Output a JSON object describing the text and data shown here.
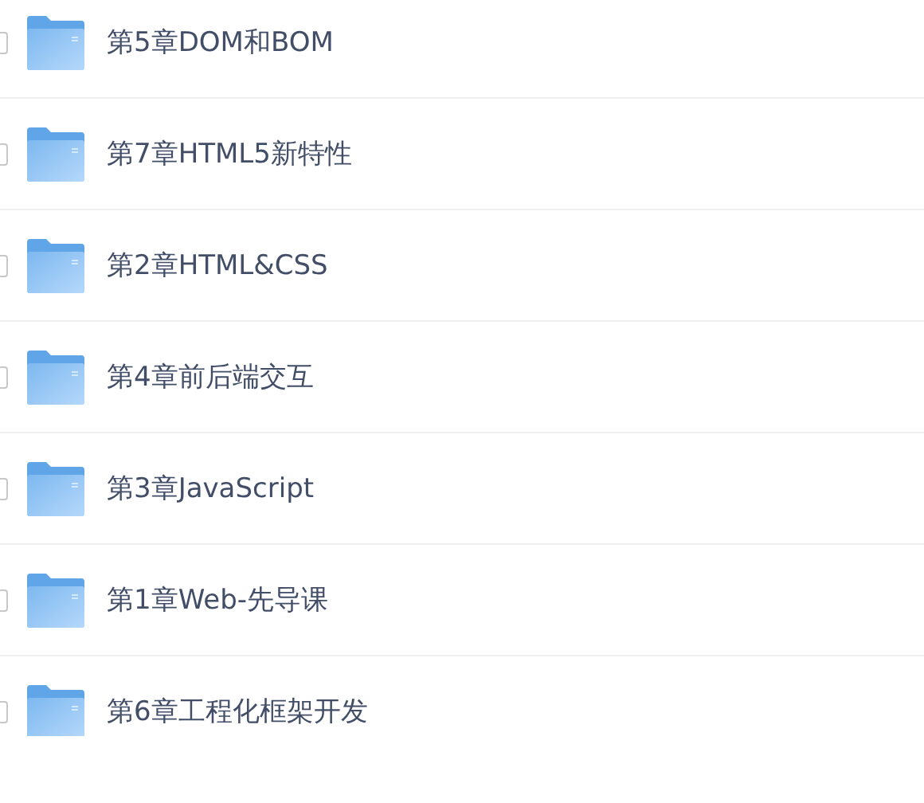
{
  "folders": [
    {
      "name": "第5章DOM和BOM",
      "checked": false
    },
    {
      "name": "第7章HTML5新特性",
      "checked": false
    },
    {
      "name": "第2章HTML&CSS",
      "checked": false
    },
    {
      "name": "第4章前后端交互",
      "checked": false
    },
    {
      "name": "第3章JavaScript",
      "checked": false
    },
    {
      "name": "第1章Web-先导课",
      "checked": false
    },
    {
      "name": "第6章工程化框架开发",
      "checked": false
    }
  ]
}
